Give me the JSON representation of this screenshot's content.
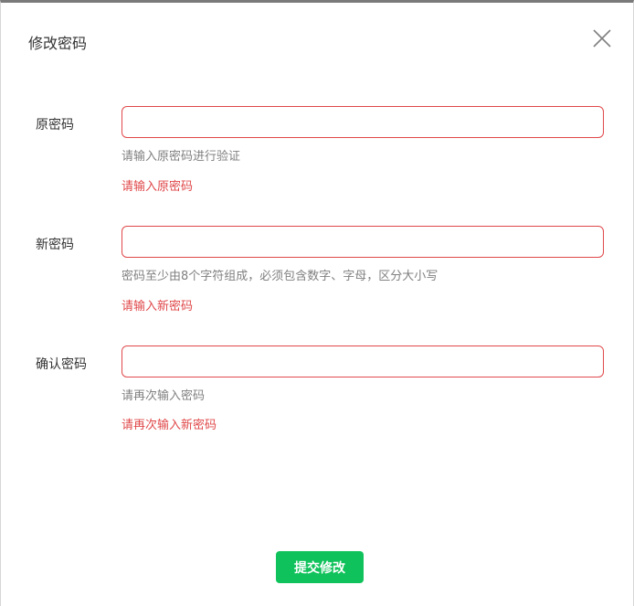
{
  "dialog": {
    "title": "修改密码"
  },
  "fields": [
    {
      "label": "原密码",
      "value": "",
      "hint": "请输入原密码进行验证",
      "error": "请输入原密码"
    },
    {
      "label": "新密码",
      "value": "",
      "hint": "密码至少由8个字符组成，必须包含数字、字母，区分大小写",
      "error": "请输入新密码"
    },
    {
      "label": "确认密码",
      "value": "",
      "hint": "请再次输入密码",
      "error": "请再次输入新密码"
    }
  ],
  "actions": {
    "submit_label": "提交修改"
  },
  "icons": {
    "close": "close-icon"
  },
  "colors": {
    "error": "#e0484a",
    "primary": "#10c25b",
    "hint": "#808080"
  }
}
